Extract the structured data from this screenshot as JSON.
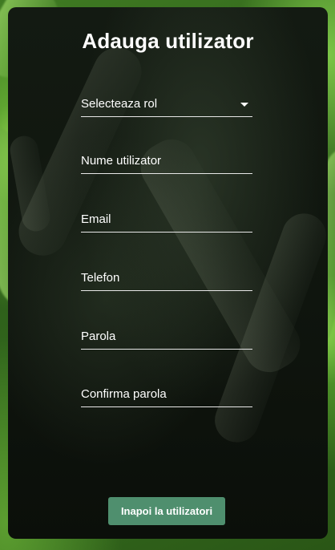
{
  "form": {
    "title": "Adauga utilizator",
    "fields": [
      {
        "name": "role-select",
        "label": "Selecteaza rol"
      },
      {
        "name": "username-field",
        "label": "Nume utilizator"
      },
      {
        "name": "email-field",
        "label": "Email"
      },
      {
        "name": "phone-field",
        "label": "Telefon"
      },
      {
        "name": "password-field",
        "label": "Parola"
      },
      {
        "name": "confirm-password-field",
        "label": "Confirma parola"
      }
    ],
    "back_button": "Inapoi la utilizatori"
  },
  "icons": {
    "dropdown": "chevron-down-icon"
  },
  "colors": {
    "accent_button": "#4f8f6e",
    "background_green": "#3f7a22",
    "card": "#111811"
  }
}
